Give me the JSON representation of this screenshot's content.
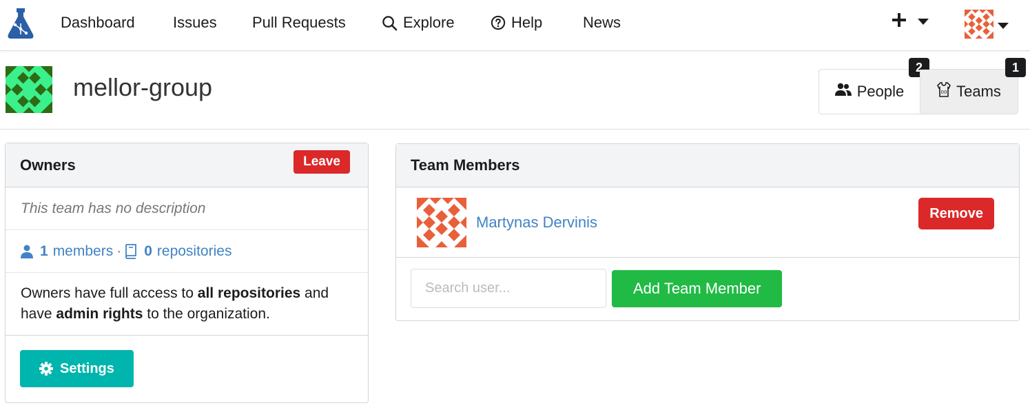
{
  "nav": {
    "items": [
      {
        "label": "Dashboard",
        "icon": ""
      },
      {
        "label": "Issues",
        "icon": ""
      },
      {
        "label": "Pull Requests",
        "icon": ""
      },
      {
        "label": "Explore",
        "icon": "search-icon"
      },
      {
        "label": "Help",
        "icon": "question-circle-icon"
      },
      {
        "label": "News",
        "icon": ""
      }
    ],
    "create_icon": "plus-icon",
    "user_menu_icon": "user-avatar"
  },
  "org": {
    "name": "mellor-group",
    "tabs": [
      {
        "label": "People",
        "count": "2",
        "icon": "people-icon"
      },
      {
        "label": "Teams",
        "count": "1",
        "icon": "jersey-icon"
      }
    ]
  },
  "team": {
    "name": "Owners",
    "leave_label": "Leave",
    "description": "This team has no description",
    "members_count": "1",
    "members_label": "members",
    "separator": "·",
    "repos_count": "0",
    "repos_label": "repositories",
    "access_text_1": "Owners have full access to",
    "access_bold_1": "all repositories",
    "access_text_2": "and have",
    "access_bold_2": "admin rights",
    "access_text_3": "to the organization.",
    "settings_label": "Settings"
  },
  "members_panel": {
    "title": "Team Members",
    "members": [
      {
        "name": "Martynas Dervinis",
        "remove_label": "Remove"
      }
    ],
    "search_placeholder": "Search user...",
    "add_label": "Add Team Member"
  },
  "colors": {
    "danger": "#db2828",
    "teal": "#00b5ad",
    "green": "#21ba45",
    "link": "#4183c4",
    "org_avatar_green": "#3cf08c",
    "org_avatar_dark": "#2d6b14",
    "user_avatar": "#e8603a"
  }
}
